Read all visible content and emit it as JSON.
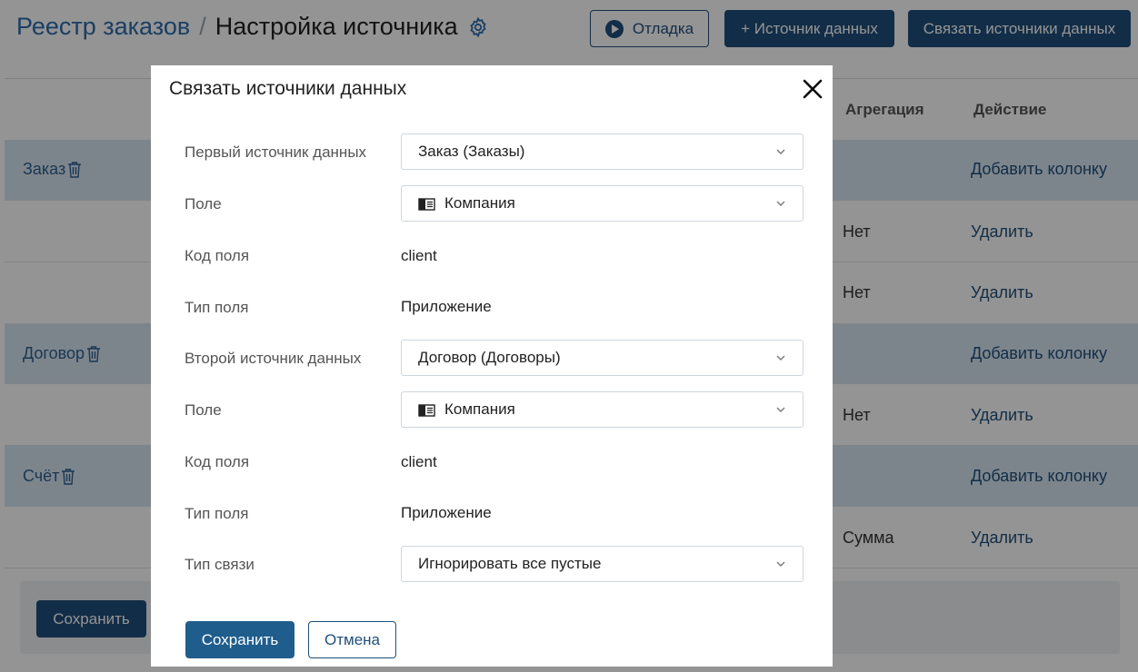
{
  "header": {
    "breadcrumb_root": "Реестр заказов",
    "separator": "/",
    "title": "Настройка источника",
    "debug_label": "Отладка",
    "add_source_label": "+ Источник данных",
    "link_sources_label": "Связать источники данных"
  },
  "table": {
    "columns": {
      "aggregation": "Агрегация",
      "action": "Действие"
    },
    "rows": [
      {
        "type": "group",
        "name": "Заказ",
        "action": "Добавить колонку"
      },
      {
        "type": "row",
        "aggregation": "Нет",
        "action": "Удалить"
      },
      {
        "type": "row",
        "aggregation": "Нет",
        "action": "Удалить"
      },
      {
        "type": "group",
        "name": "Договор",
        "action": "Добавить колонку"
      },
      {
        "type": "row",
        "aggregation": "Нет",
        "action": "Удалить"
      },
      {
        "type": "group",
        "name": "Счёт",
        "action": "Добавить колонку"
      },
      {
        "type": "row",
        "aggregation": "Сумма",
        "action": "Удалить"
      }
    ]
  },
  "footer": {
    "save_label": "Сохранить"
  },
  "modal": {
    "title": "Связать источники данных",
    "first_source_label": "Первый источник данных",
    "first_source_value": "Заказ (Заказы)",
    "field1_label": "Поле",
    "field1_value": "Компания",
    "field_code1_label": "Код поля",
    "field_code1_value": "client",
    "field_type1_label": "Тип поля",
    "field_type1_value": "Приложение",
    "second_source_label": "Второй источник данных",
    "second_source_value": "Договор (Договоры)",
    "field2_label": "Поле",
    "field2_value": "Компания",
    "field_code2_label": "Код поля",
    "field_code2_value": "client",
    "field_type2_label": "Тип поля",
    "field_type2_value": "Приложение",
    "link_type_label": "Тип связи",
    "link_type_value": "Игнорировать все пустые",
    "save_label": "Сохранить",
    "cancel_label": "Отмена"
  },
  "icons": {
    "gear": "gear-icon",
    "play": "play-icon",
    "trash": "trash-icon",
    "close": "close-icon",
    "chevron": "chevron-down-icon",
    "app": "app-icon"
  },
  "colors": {
    "primary": "#1f4f7a",
    "link": "#2d6cad",
    "group_row": "#d7e6f2",
    "overlay": "rgba(0,0,0,0.42)"
  }
}
